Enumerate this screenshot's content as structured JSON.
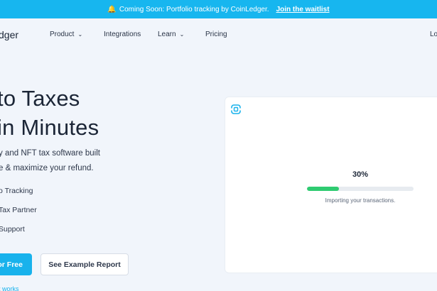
{
  "banner": {
    "icon": "bell-icon",
    "text": "Coming Soon: Portfolio tracking by CoinLedger.",
    "cta": "Join the waitlist"
  },
  "nav": {
    "logo_text": "dger",
    "items": [
      {
        "label": "Product",
        "has_dropdown": true
      },
      {
        "label": "Integrations",
        "has_dropdown": false
      },
      {
        "label": "Learn",
        "has_dropdown": true
      },
      {
        "label": "Pricing",
        "has_dropdown": false
      }
    ],
    "login": "Lo"
  },
  "hero": {
    "title_line1": "to Taxes",
    "title_line2": "in Minutes",
    "desc_line1": "y and NFT tax software built",
    "desc_line2": "e & maximize your refund.",
    "features": [
      "o Tracking",
      "Tax Partner",
      "Support"
    ],
    "primary_button": "or Free",
    "secondary_button": "See Example Report",
    "how_link": "it works"
  },
  "card": {
    "progress_label": "30%",
    "progress_fraction": 0.3,
    "status": "Importing your transactions.",
    "accent_color": "#18b2ec",
    "progress_color": "#2fcb71"
  }
}
